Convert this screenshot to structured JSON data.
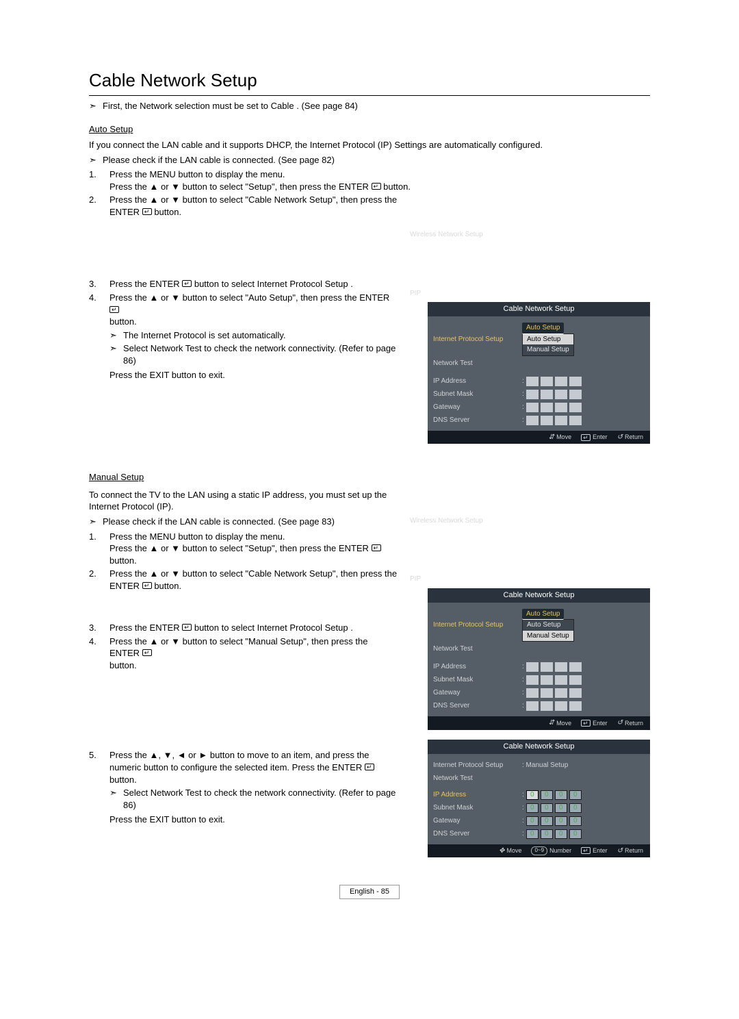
{
  "title": "Cable Network Setup",
  "topNote": "First, the  Network selection  must be set to  Cable . (See page 84)",
  "auto": {
    "label": "Auto Setup",
    "intro": "If you connect the LAN cable and it supports DHCP, the Internet Protocol (IP) Settings are automatically configured.",
    "check": "Please check if the LAN cable is connected. (See page 82)",
    "step1a": "Press the MENU button to display the menu.",
    "step1b": "Press the ▲ or ▼ button to select \"Setup\", then press the ENTER",
    "step1c": "button.",
    "step2a": "Press the ▲ or ▼ button to select \"Cable Network Setup\", then press the",
    "step2b": "ENTER",
    "step2c": "button.",
    "step3a": "Press the ENTER",
    "step3b": "button to select  Internet Protocol Setup .",
    "step4a": "Press the ▲ or ▼ button to select \"Auto Setup\", then press the ENTER",
    "step4b": "button.",
    "sub4a": "The Internet Protocol is set automatically.",
    "sub4b": "Select  Network Test  to check the network connectivity. (Refer to page 86)",
    "exit": "Press the EXIT button to exit."
  },
  "ghost1": "Wireless Network Setup",
  "ghost2": "PIP",
  "manual": {
    "label": "Manual Setup",
    "intro": "To connect the TV to the LAN using a static IP address, you must set up the Internet Protocol (IP).",
    "check": "Please check if the LAN cable is connected. (See page 83)",
    "step1a": "Press the MENU button to display the menu.",
    "step1b": "Press the ▲ or ▼ button to select \"Setup\", then press the ENTER",
    "step1c": "button.",
    "step2a": "Press the ▲ or ▼ button to select \"Cable Network Setup\", then press the",
    "step2b": "ENTER",
    "step2c": "button.",
    "step3a": "Press the ENTER",
    "step3b": "button to select  Internet Protocol Setup .",
    "step4a": "Press the ▲ or ▼ button to select \"Manual Setup\", then press the ENTER",
    "step4b": "button.",
    "step5a": "Press the ▲, ▼, ◄ or ► button to move to an item, and press the numeric button to configure the selected item. Press the ENTER",
    "step5b": "button.",
    "sub5a": "Select  Network Test  to check the network connectivity. (Refer to page 86)",
    "exit": "Press the EXIT button to exit."
  },
  "osd": {
    "title": "Cable Network Setup",
    "ips_label": "Internet Protocol Setup",
    "auto_opt": "Auto Setup",
    "manual_opt": "Manual Setup",
    "nt_label": "Network Test",
    "ip_label": "IP Address",
    "sm_label": "Subnet Mask",
    "gw_label": "Gateway",
    "dns_label": "DNS Server",
    "ips_val_manual": ": Manual Setup",
    "zero": "0",
    "move": "Move",
    "enter": "Enter",
    "ret": "Return",
    "number": "Number",
    "numrange": "0~9"
  },
  "footer": "English - 85"
}
